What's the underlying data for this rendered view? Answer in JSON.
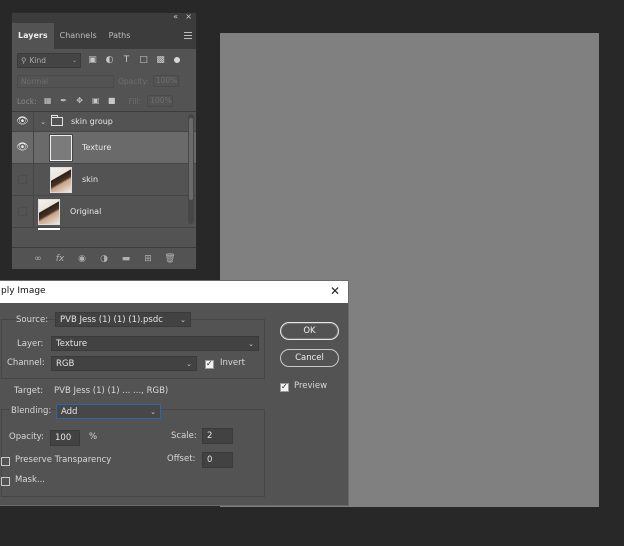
{
  "layers_panel": {
    "tabs": [
      {
        "label": "Layers",
        "active": true
      },
      {
        "label": "Channels",
        "active": false
      },
      {
        "label": "Paths",
        "active": false
      }
    ],
    "kind_filter": "Kind",
    "blend_mode": "Normal",
    "opacity_label": "Opacity:",
    "opacity_value": "100%",
    "lock_label": "Lock:",
    "fill_label": "Fill:",
    "fill_value": "100%",
    "layers": [
      {
        "name": "skin group",
        "type": "group",
        "visible": true
      },
      {
        "name": "Texture",
        "type": "layer",
        "visible": true,
        "selected": true
      },
      {
        "name": "skin",
        "type": "layer",
        "visible": false
      },
      {
        "name": "Original",
        "type": "layer",
        "visible": false
      }
    ]
  },
  "dialog": {
    "title": "ply Image",
    "source_label": "Source:",
    "source_value": "PVB Jess (1) (1) (1).psdc",
    "layer_label": "Layer:",
    "layer_value": "Texture",
    "channel_label": "Channel:",
    "channel_value": "RGB",
    "invert_label": "Invert",
    "invert_checked": true,
    "target_label": "Target:",
    "target_value": "PVB Jess (1) (1) ... ..., RGB)",
    "blending_label": "Blending:",
    "blending_value": "Add",
    "opacity_label": "Opacity:",
    "opacity_value": "100",
    "opacity_unit": "%",
    "scale_label": "Scale:",
    "scale_value": "2",
    "offset_label": "Offset:",
    "offset_value": "0",
    "preserve_label": "Preserve Transparency",
    "mask_label": "Mask...",
    "ok_label": "OK",
    "cancel_label": "Cancel",
    "preview_label": "Preview",
    "preview_checked": true
  },
  "colors": {
    "workspace": "#282828",
    "panel": "#535353",
    "canvas": "#808080",
    "focus_border": "#2f66a8"
  }
}
